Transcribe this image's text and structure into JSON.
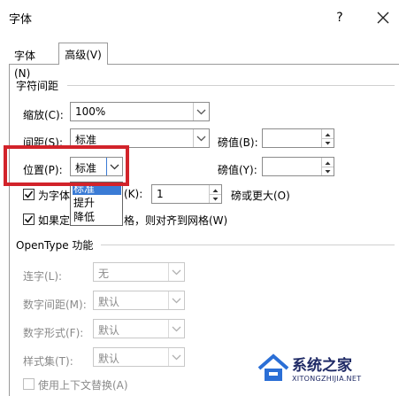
{
  "dialog": {
    "title": "字体",
    "help_label": "?",
    "close_icon": "close-icon"
  },
  "tabs": [
    {
      "label": "字体(N)",
      "active": false
    },
    {
      "label": "高级(V)",
      "active": true
    }
  ],
  "char_spacing": {
    "section_title": "字符间距",
    "scale_label": "缩放(C):",
    "scale_value": "100%",
    "spacing_label": "间距(S):",
    "spacing_value": "标准",
    "spacing_by_label": "磅值(B):",
    "spacing_by_value": "",
    "position_label": "位置(P):",
    "position_value": "标准",
    "position_by_label": "磅值(Y):",
    "position_by_value": "",
    "position_options": [
      "标准",
      "提升",
      "降低"
    ],
    "kerning_label_left": "为字体",
    "kerning_label_mid": "(K):",
    "kerning_value": "1",
    "kerning_suffix": "磅或更大(O)",
    "kerning_checked": true,
    "grid_label_left": "如果定",
    "grid_label_right": "格，则对齐到网格(W)",
    "grid_checked": true
  },
  "opentype": {
    "section_title": "OpenType 功能",
    "ligatures_label": "连字(L):",
    "ligatures_value": "无",
    "num_spacing_label": "数字间距(M):",
    "num_spacing_value": "默认",
    "num_forms_label": "数字形式(F):",
    "num_forms_value": "默认",
    "stylistic_label": "样式集(T):",
    "stylistic_value": "默认",
    "contextual_label": "使用上下文替换(A)",
    "contextual_checked": false
  },
  "watermark": {
    "text": "系统之家",
    "url": "XITONGZHIJIA.NET"
  },
  "colors": {
    "highlight": "#d2232a",
    "selection": "#3a7bd5"
  }
}
